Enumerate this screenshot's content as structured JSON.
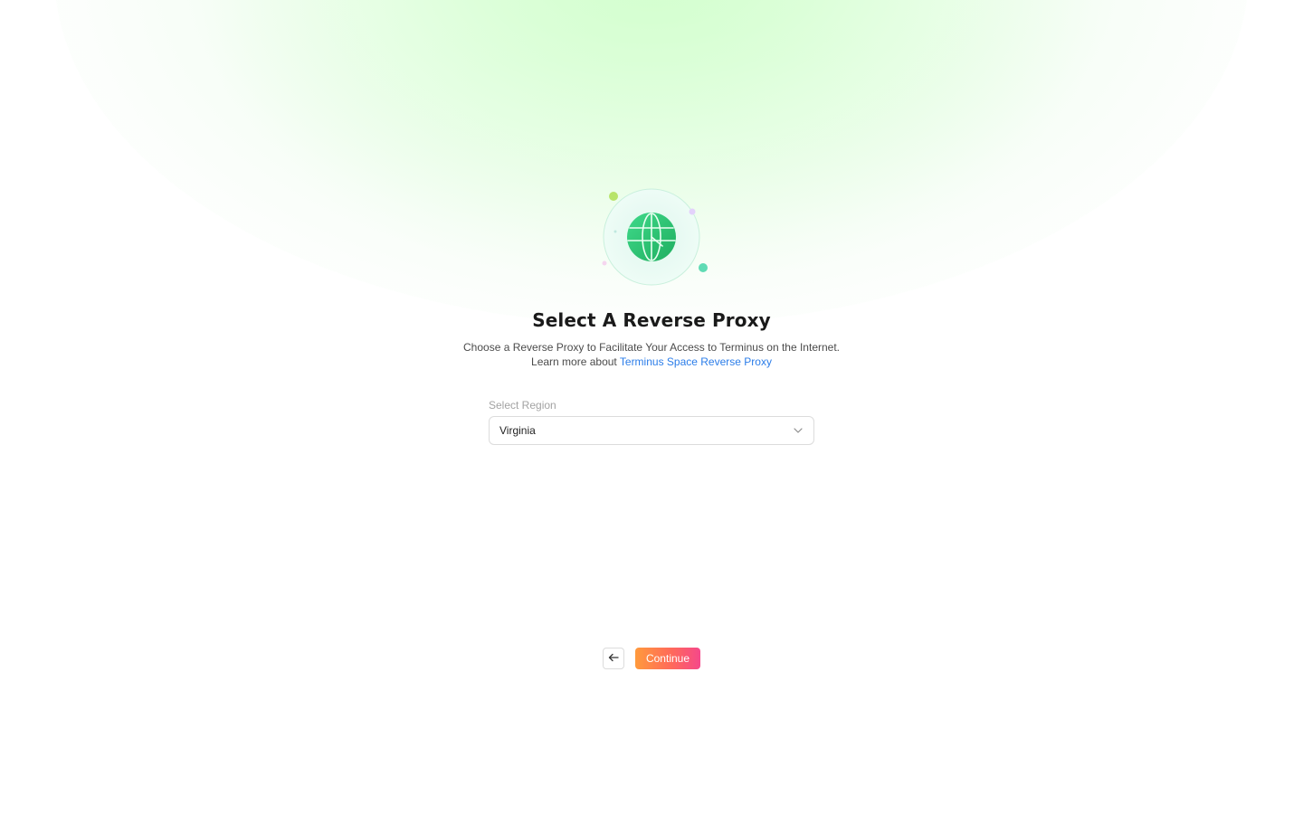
{
  "header": {
    "title": "Select A Reverse Proxy",
    "subtitle_line1": "Choose a Reverse Proxy to Facilitate Your Access to Terminus on the Internet.",
    "subtitle_line2_prefix": "Learn more about ",
    "learn_more_link": "Terminus Space Reverse Proxy"
  },
  "form": {
    "region_label": "Select Region",
    "region_value": "Virginia"
  },
  "footer": {
    "back_icon": "arrow-left-icon",
    "continue_label": "Continue"
  },
  "icons": {
    "illustration": "globe-icon",
    "dropdown": "chevron-down-icon"
  },
  "colors": {
    "accent_link": "#2b7de9",
    "globe_green": "#2ecc71",
    "button_gradient_start": "#ff9a3c",
    "button_gradient_end": "#f5488a"
  }
}
